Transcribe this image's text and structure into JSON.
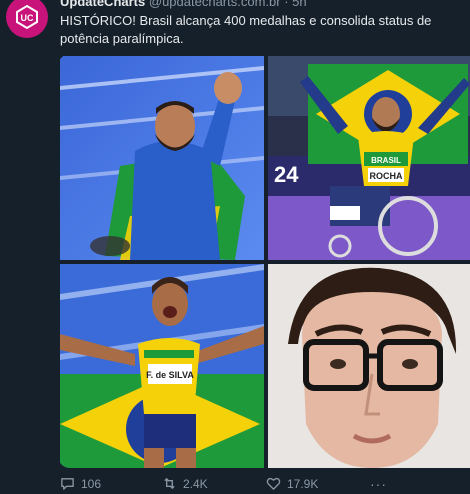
{
  "author": {
    "name": "UpdateCharts",
    "handle": "@updatecharts.com.br",
    "time": "5h",
    "avatar_icon": "update-charts-logo-icon",
    "avatar_color": "#c8147a"
  },
  "tweet": {
    "text": "HISTÓRICO! Brasil alcança 400 medalhas e consolida status de potência paralímpica."
  },
  "media": {
    "photo1": {
      "subject": "athlete-waving-with-brazil-flag"
    },
    "photo2": {
      "subject": "wheelchair-athlete-holding-brazil-flag",
      "bib_text": "ROCHA",
      "jersey_text": "BRASIL",
      "board_text": "24"
    },
    "photo3": {
      "subject": "sprinter-celebrating-with-flag",
      "bib_text": "F. de SILVA"
    },
    "photo4": {
      "subject": "young-man-with-glasses-selfie"
    }
  },
  "actions": {
    "reply_count": "106",
    "retweet_count": "2.4K",
    "like_count": "17.9K",
    "more_label": "···"
  },
  "colors": {
    "background": "#15202b",
    "text": "#e7e9ea",
    "secondary": "#8b98a5",
    "brazil_green": "#1e9a3a",
    "brazil_yellow": "#f5d10a"
  }
}
